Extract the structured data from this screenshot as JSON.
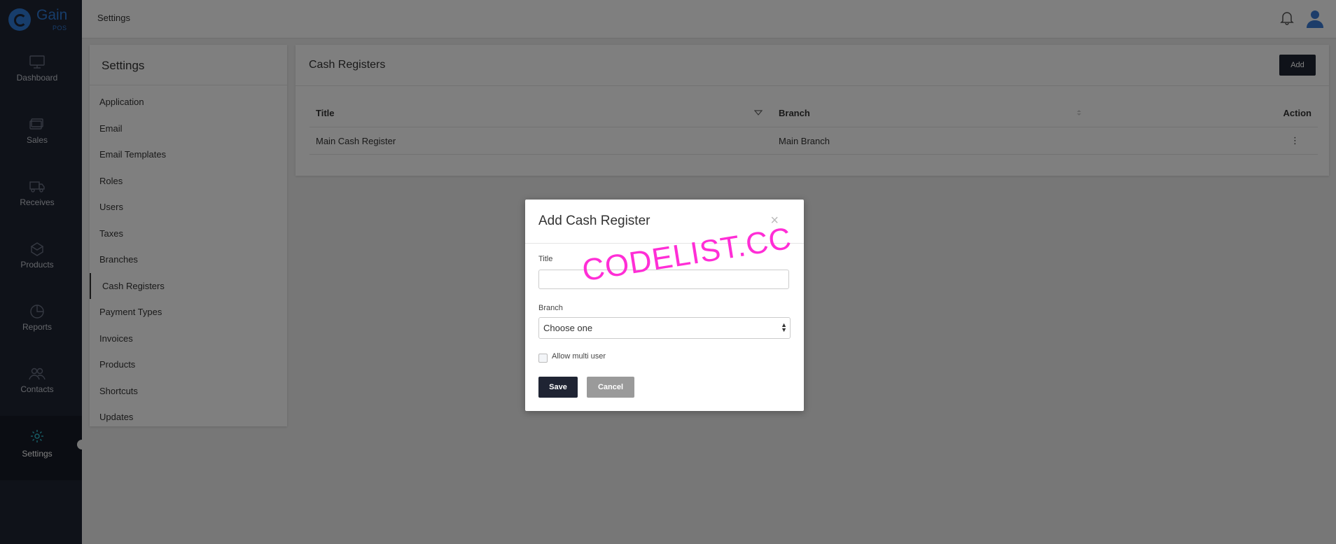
{
  "app": {
    "logo_name": "Gain",
    "logo_sub": "POS",
    "brand_color": "#2e7bd6",
    "nav_bg": "#1f2433"
  },
  "sidebar": {
    "items": [
      {
        "label": "Dashboard",
        "icon": "monitor-icon"
      },
      {
        "label": "Sales",
        "icon": "cards-icon"
      },
      {
        "label": "Receives",
        "icon": "truck-icon"
      },
      {
        "label": "Products",
        "icon": "box-icon"
      },
      {
        "label": "Reports",
        "icon": "pie-chart-icon"
      },
      {
        "label": "Contacts",
        "icon": "users-icon"
      },
      {
        "label": "Settings",
        "icon": "gear-icon",
        "active": true
      }
    ]
  },
  "header": {
    "title": "Settings"
  },
  "settings_panel": {
    "title": "Settings",
    "items": [
      "Application",
      "Email",
      "Email Templates",
      "Roles",
      "Users",
      "Taxes",
      "Branches",
      "Cash Registers",
      "Payment Types",
      "Invoices",
      "Products",
      "Shortcuts",
      "Updates"
    ],
    "active": "Cash Registers"
  },
  "cash_registers": {
    "title": "Cash Registers",
    "add_label": "Add",
    "columns": {
      "title": "Title",
      "branch": "Branch",
      "action": "Action"
    },
    "rows": [
      {
        "title": "Main Cash Register",
        "branch": "Main Branch",
        "action": "⋮"
      }
    ]
  },
  "modal": {
    "title": "Add Cash Register",
    "close": "×",
    "title_label": "Title",
    "title_value": "",
    "branch_label": "Branch",
    "branch_selected": "Choose one",
    "multi_user_label": "Allow multi user",
    "multi_user_checked": false,
    "save_label": "Save",
    "cancel_label": "Cancel"
  },
  "watermark": "CODELIST.CC"
}
